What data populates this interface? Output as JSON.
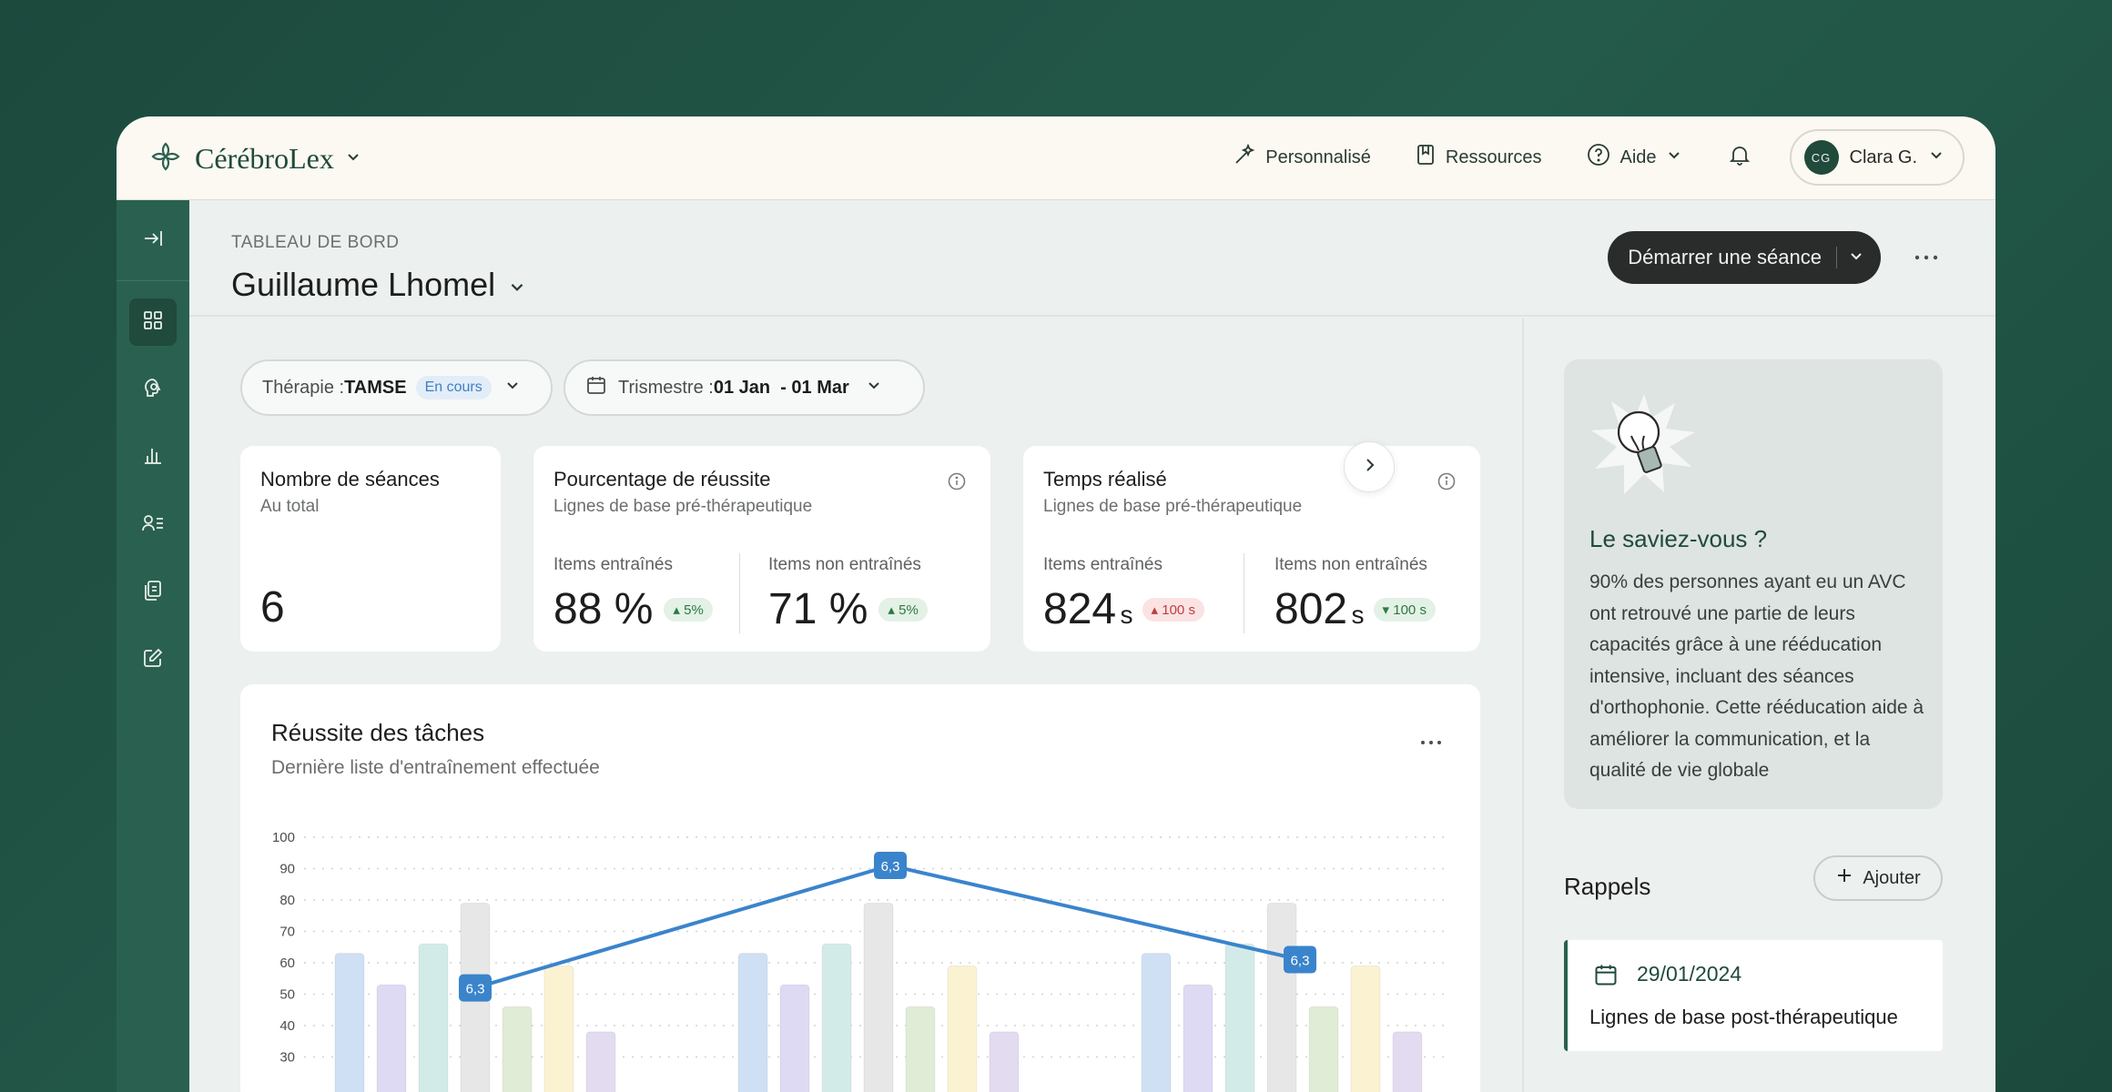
{
  "brand": {
    "name": "CérébroLex"
  },
  "nav": {
    "custom": "Personnalisé",
    "resources": "Ressources",
    "help": "Aide"
  },
  "user": {
    "initials": "CG",
    "name": "Clara G."
  },
  "header": {
    "breadcrumb": "TABLEAU DE BORD",
    "patient": "Guillaume Lhomel",
    "start_label": "Démarrer une séance"
  },
  "filters": {
    "therapy_label": "Thérapie : ",
    "therapy_value": "TAMSE",
    "therapy_status": "En cours",
    "period_label": "Trismestre : ",
    "period_value": "01 Jan  - 01 Mar"
  },
  "stats": {
    "sessions": {
      "title": "Nombre de séances",
      "subtitle": "Au total",
      "value": "6"
    },
    "success": {
      "title": "Pourcentage de réussite",
      "subtitle": "Lignes de base pré-thérapeutique",
      "trained_label": "Items entraînés",
      "trained_value": "88 %",
      "trained_delta": "5%",
      "untrained_label": "Items non entraînés",
      "untrained_value": "71 %",
      "untrained_delta": "5%"
    },
    "time": {
      "title": "Temps réalisé",
      "subtitle": "Lignes de base pré-thérapeutique",
      "trained_label": "Items entraînés",
      "trained_value": "824",
      "trained_unit": "s",
      "trained_delta": "100 s",
      "untrained_label": "Items non entraînés",
      "untrained_value": "802",
      "untrained_unit": "s",
      "untrained_delta": "100 s"
    }
  },
  "chart_card": {
    "title": "Réussite des tâches",
    "subtitle": "Dernière liste d'entraînement effectuée"
  },
  "chart_data": {
    "type": "bar",
    "y_ticks": [
      30,
      40,
      50,
      60,
      70,
      80,
      90,
      100
    ],
    "ylim": [
      30,
      100
    ],
    "groups": 3,
    "bar_colors": [
      "#cfe0f4",
      "#dedaf3",
      "#d3ebe8",
      "#e7e7e7",
      "#e1ecd6",
      "#fbf2d2",
      "#e3dbf0"
    ],
    "group_values": [
      63,
      53,
      66,
      79,
      46,
      59,
      38
    ],
    "line": {
      "color": "#3a84cc",
      "values": [
        52,
        91,
        61
      ],
      "labels": [
        "6,3",
        "6,3",
        "6,3"
      ]
    }
  },
  "tip": {
    "title": "Le saviez-vous ?",
    "text": "90% des personnes ayant eu un AVC ont retrouvé une partie de leurs capacités grâce à une rééducation intensive, incluant des séances d'orthophonie. Cette rééducation aide à améliorer la communication, et la qualité de vie globale"
  },
  "reminders": {
    "title": "Rappels",
    "add_label": "Ajouter",
    "items": [
      {
        "date": "29/01/2024",
        "text": "Lignes de base post-thérapeutique"
      }
    ]
  },
  "colors": {
    "brand": "#1f4a3c",
    "sidebar": "#2a6050",
    "accent": "#3a84cc"
  }
}
